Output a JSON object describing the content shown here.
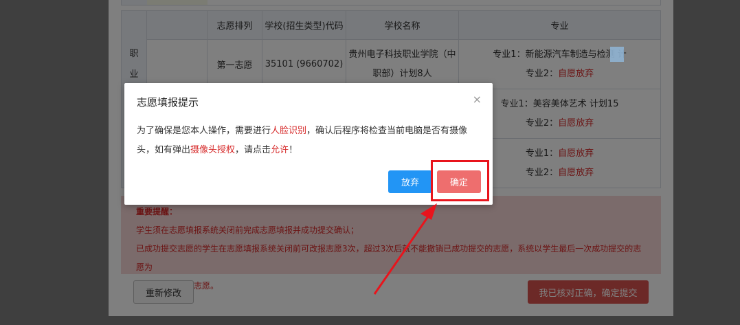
{
  "table": {
    "headers": [
      "志愿排列",
      "学校(招生类型)代码",
      "学校名称",
      "专业"
    ],
    "side_label": [
      "职",
      "业"
    ],
    "rows": [
      {
        "order": "第一志愿",
        "code": "35101 (9660702)",
        "school_line1": "贵州电子科技职业学院（中",
        "school_line2": "职部）计划8人",
        "major1": "专业1：新能源汽车制造与检测 计",
        "major2_prefix": "专业2：",
        "major2_value": "自愿放弃"
      },
      {
        "order": "",
        "code": "",
        "school_line1": "",
        "school_line2": "",
        "major1": "专业1：美容美体艺术 计划15",
        "major2_prefix": "专业2：",
        "major2_value": "自愿放弃"
      },
      {
        "order": "",
        "code": "",
        "school_line1": "",
        "school_line2": "",
        "major1_prefix": "专业1：",
        "major1_value": "自愿放弃",
        "major2_prefix": "专业2：",
        "major2_value": "自愿放弃"
      }
    ]
  },
  "notice": {
    "title": "重要提醒：",
    "line1": "学生须在志愿填报系统关闭前完成志愿填报并成功提交确认；",
    "line2": "已成功提交志愿的学生在志愿填报系统关闭前可改报志愿3次，超过3次后就不能撤销已成功提交的志愿，系统以学生最后一次成功提交的志愿为",
    "line3": "该生最终填报的志愿。"
  },
  "buttons": {
    "redo": "重新修改",
    "submit": "我已核对正确，确定提交"
  },
  "modal": {
    "title": "志愿填报提示",
    "close": "×",
    "body_p1": "为了确保是您本人操作，需要进行",
    "body_face": "人脸识别",
    "body_p2": "，确认后程序将检查当前电脑是否有摄像头，如有弹出",
    "body_camera": "摄像头授权",
    "body_p3": "，请点击",
    "body_allow": "允许",
    "body_p4": "！",
    "giveup": "放弃",
    "confirm": "确定"
  },
  "colors": {
    "accent_red": "#d62828",
    "confirm_button": "#ee6e6e",
    "giveup_button": "#2295f5",
    "submit_button": "#d9534f",
    "highlight_box": "#e8141c"
  }
}
